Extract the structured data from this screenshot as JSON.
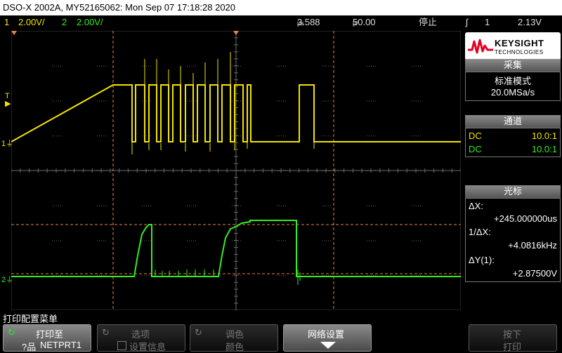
{
  "title": "DSO-X 2002A, MY52165062: Mon Sep 07 17:18:28 2020",
  "status": {
    "ch1_num": "1",
    "ch1_scale": "2.00V/",
    "ch2_num": "2",
    "ch2_scale": "2.00V/",
    "time_offset": "3.588",
    "time_offset_unit": "µs",
    "time_scale": "50.00",
    "time_scale_unit": "µ/",
    "run_state": "停止",
    "trigger_ch": "1",
    "trigger_level": "2.13V"
  },
  "logo": {
    "line1": "KEYSIGHT",
    "line2": "TECHNOLOGIES"
  },
  "acquire": {
    "header": "采集",
    "mode": "标准模式",
    "rate": "20.0MSa/s"
  },
  "channels": {
    "header": "通道",
    "rows": [
      {
        "coupling": "DC",
        "probe": "10.0:1",
        "color": "#f2e400"
      },
      {
        "coupling": "DC",
        "probe": "10.0:1",
        "color": "#33ee22"
      }
    ]
  },
  "cursors": {
    "header": "光标",
    "dx_label": "ΔX:",
    "dx_value": "+245.000000us",
    "inv_label": "1/ΔX:",
    "inv_value": "+4.0816kHz",
    "dy_label": "ΔY(1):",
    "dy_value": "+2.87500V"
  },
  "markers": {
    "trigger": "T",
    "ch1": "1",
    "ch2": "2"
  },
  "menu": {
    "title": "打印配置菜单",
    "softkeys": [
      {
        "line1": "打印至",
        "line2": "NETPRT1"
      },
      {
        "line1": "选项",
        "line2": "设置信息"
      },
      {
        "line1": "调色",
        "line2": "颜色"
      },
      {
        "line1": "网络设置",
        "line2": ""
      },
      {
        "line1": "按下",
        "line2": "打印"
      }
    ]
  },
  "colors": {
    "ch1": "#f2e400",
    "ch2": "#33ee22",
    "cursor": "#e8834a",
    "grid": "#555555"
  }
}
